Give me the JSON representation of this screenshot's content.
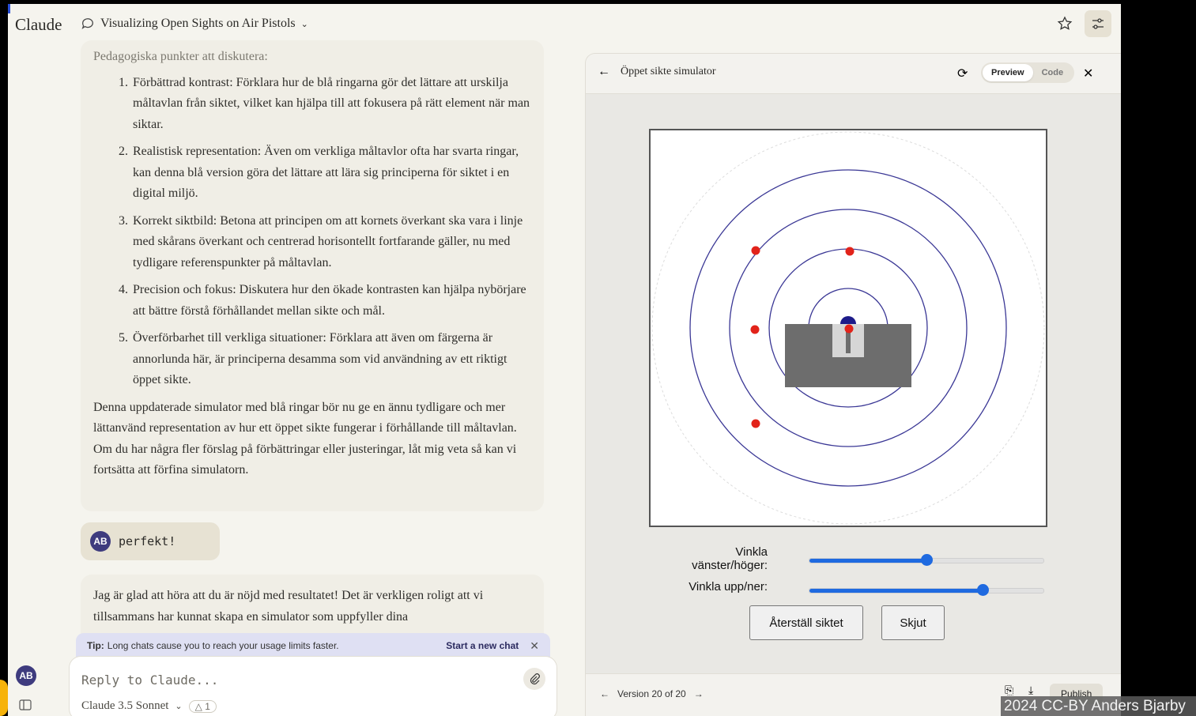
{
  "app": {
    "brand": "Claude",
    "conversation_title": "Visualizing Open Sights on Air Pistols"
  },
  "chat": {
    "fade_heading": "Pedagogiska punkter att diskutera:",
    "points": [
      "Förbättrad kontrast: Förklara hur de blå ringarna gör det lättare att urskilja måltavlan från siktet, vilket kan hjälpa till att fokusera på rätt element när man siktar.",
      "Realistisk representation: Även om verkliga måltavlor ofta har svarta ringar, kan denna blå version göra det lättare att lära sig principerna för siktet i en digital miljö.",
      "Korrekt siktbild: Betona att principen om att kornets överkant ska vara i linje med skårans överkant och centrerad horisontellt fortfarande gäller, nu med tydligare referenspunkter på måltavlan.",
      "Precision och fokus: Diskutera hur den ökade kontrasten kan hjälpa nybörjare att bättre förstå förhållandet mellan sikte och mål.",
      "Överförbarhet till verkliga situationer: Förklara att även om färgerna är annorlunda här, är principerna desamma som vid användning av ett riktigt öppet sikte."
    ],
    "summary": "Denna uppdaterade simulator med blå ringar bör nu ge en ännu tydligare och mer lättanvänd representation av hur ett öppet sikte fungerar i förhållande till måltavlan. Om du har några fler förslag på förbättringar eller justeringar, låt mig veta så kan vi fortsätta att förfina simulatorn.",
    "user_initials": "AB",
    "user_message": "perfekt!",
    "reply_text": "Jag är glad att höra att du är nöjd med resultatet! Det är verkligen roligt att vi tillsammans har kunnat skapa en simulator som uppfyller dina"
  },
  "tip": {
    "label": "Tip:",
    "text": "Long chats cause you to reach your usage limits faster.",
    "action": "Start a new chat"
  },
  "composer": {
    "placeholder": "Reply to Claude...",
    "model": "Claude 3.5 Sonnet",
    "project_count": "1"
  },
  "artifact": {
    "title": "Öppet sikte simulator",
    "tabs": {
      "preview": "Preview",
      "code": "Code"
    },
    "slider1_label": "Vinkla vänster/höger:",
    "slider1_value": 0.5,
    "slider2_label": "Vinkla upp/ner:",
    "slider2_value": 0.74,
    "reset_button": "Återställ siktet",
    "shoot_button": "Skjut",
    "version": "Version 20 of 20",
    "publish": "Publish"
  },
  "colors": {
    "accent": "#1f6ae0",
    "ring": "#3a3795",
    "hit": "#e2231a",
    "avatar": "#3e3b7e"
  },
  "watermark": "2024 CC-BY Anders Bjarby"
}
